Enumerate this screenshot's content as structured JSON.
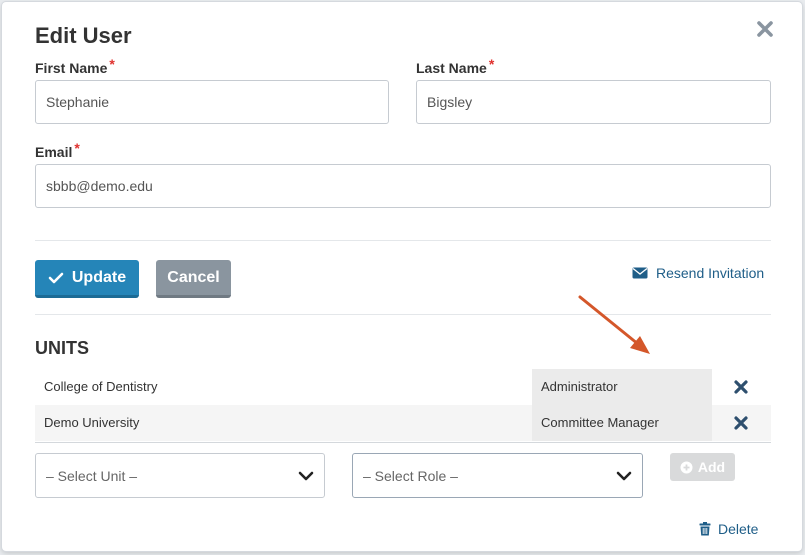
{
  "modal": {
    "title": "Edit User"
  },
  "form": {
    "first_name": {
      "label": "First Name",
      "required": "*",
      "value": "Stephanie"
    },
    "last_name": {
      "label": "Last Name",
      "required": "*",
      "value": "Bigsley"
    },
    "email": {
      "label": "Email",
      "required": "*",
      "value": "sbbb@demo.edu"
    }
  },
  "actions": {
    "update_label": "Update",
    "cancel_label": "Cancel",
    "resend_label": "Resend Invitation"
  },
  "units": {
    "title": "UNITS",
    "rows": [
      {
        "unit": "College of Dentistry",
        "role": "Administrator"
      },
      {
        "unit": "Demo University",
        "role": "Committee Manager"
      }
    ],
    "select_unit": "– Select Unit –",
    "select_role": "– Select Role –",
    "add_label": "Add"
  },
  "footer": {
    "delete_label": "Delete"
  },
  "colors": {
    "primary": "#2585b8",
    "secondary": "#8a959f",
    "link": "#1f5e88",
    "required": "#e0322f",
    "annotation_arrow": "#d4572a"
  }
}
